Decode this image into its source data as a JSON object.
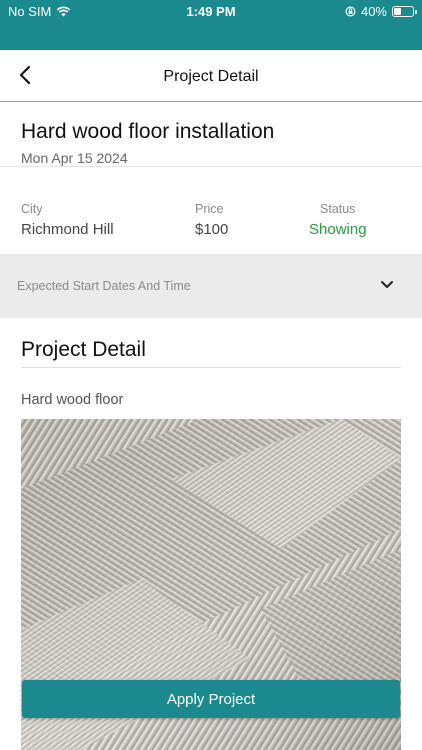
{
  "status_bar": {
    "carrier": "No SIM",
    "time": "1:49 PM",
    "battery": "40%",
    "battery_level": 0.4
  },
  "nav": {
    "title": "Project Detail"
  },
  "project": {
    "title": "Hard wood floor installation",
    "date": "Mon Apr 15 2024"
  },
  "info": {
    "city_label": "City",
    "city_value": "Richmond Hill",
    "price_label": "Price",
    "price_value": "$100",
    "status_label": "Status",
    "status_value": "Showing"
  },
  "expected": {
    "label": "Expected Start Dates And Time"
  },
  "detail": {
    "heading": "Project Detail",
    "description": "Hard wood floor"
  },
  "actions": {
    "apply_label": "Apply Project"
  },
  "colors": {
    "brand": "#1b8a8f",
    "status_green": "#2a9a44"
  }
}
